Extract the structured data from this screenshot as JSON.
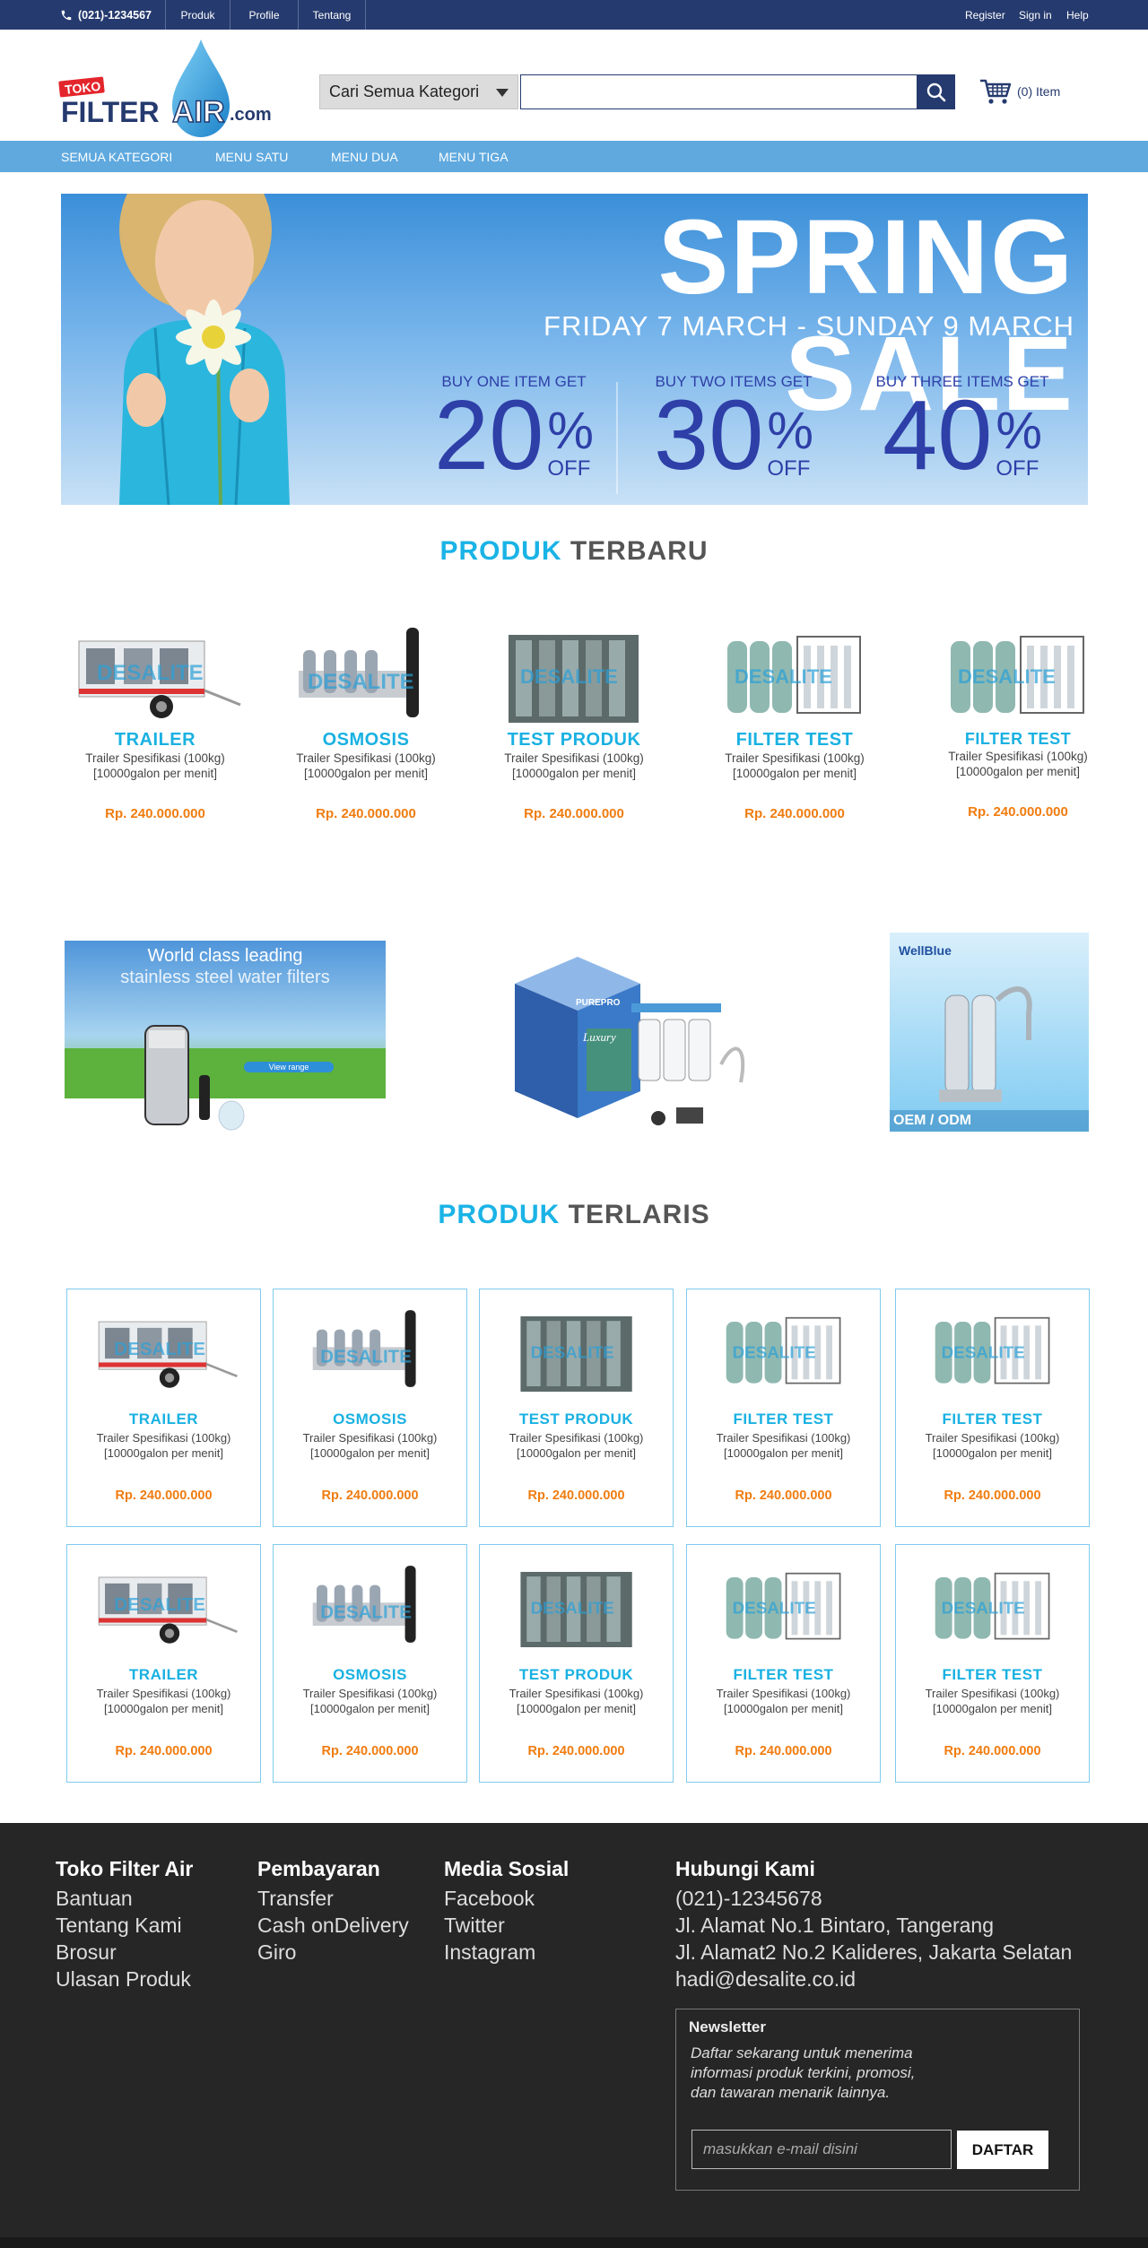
{
  "topbar": {
    "phone": "(021)-1234567",
    "links": [
      "Produk",
      "Profile",
      "Tentang"
    ],
    "right_links": [
      "Register",
      "Sign in",
      "Help"
    ]
  },
  "header": {
    "logo": {
      "top_text": "TOKO",
      "main_text": "FILTER",
      "accent_text": "AIR",
      "suffix": ".com"
    },
    "category_select": "Cari Semua Kategori",
    "search_value": "",
    "cart_label": "(0) Item"
  },
  "nav": {
    "items": [
      "SEMUA KATEGORI",
      "MENU SATU",
      "MENU DUA",
      "MENU TIGA"
    ]
  },
  "banner": {
    "title": "SPRING SALE",
    "subtitle": "FRIDAY 7 MARCH - SUNDAY 9 MARCH",
    "offers": [
      {
        "label": "BUY ONE ITEM GET",
        "value": "20",
        "pct": "%",
        "off": "OFF"
      },
      {
        "label": "BUY TWO ITEMS GET",
        "value": "30",
        "pct": "%",
        "off": "OFF"
      },
      {
        "label": "BUY THREE ITEMS GET",
        "value": "40",
        "pct": "%",
        "off": "OFF"
      }
    ]
  },
  "new_products": {
    "title_a": "PRODUK",
    "title_b": "TERBARU",
    "items": [
      {
        "name": "TRAILER",
        "desc1": "Trailer Spesifikasi (100kg)",
        "desc2": "[10000galon per menit]",
        "price": "Rp. 240.000.000"
      },
      {
        "name": "OSMOSIS",
        "desc1": "Trailer Spesifikasi (100kg)",
        "desc2": "[10000galon per menit]",
        "price": "Rp. 240.000.000"
      },
      {
        "name": "TEST PRODUK",
        "desc1": "Trailer Spesifikasi (100kg)",
        "desc2": "[10000galon per menit]",
        "price": "Rp. 240.000.000"
      },
      {
        "name": "FILTER TEST",
        "desc1": "Trailer Spesifikasi (100kg)",
        "desc2": "[10000galon per menit]",
        "price": "Rp. 240.000.000"
      },
      {
        "name": "FILTER TEST",
        "desc1": "Trailer Spesifikasi (100kg)",
        "desc2": "[10000galon per menit]",
        "price": "Rp. 240.000.000"
      }
    ]
  },
  "promos": {
    "left": {
      "headline1": "World class leading",
      "headline2": "stainless steel water filters",
      "button": "View range"
    },
    "middle": {
      "brand": "PUREPRO",
      "product": "Luxury"
    },
    "right": {
      "brand": "WellBlue",
      "caption": "OEM / ODM"
    }
  },
  "best_sellers": {
    "title_a": "PRODUK",
    "title_b": "TERLARIS",
    "rows": [
      [
        {
          "name": "TRAILER",
          "desc1": "Trailer Spesifikasi (100kg)",
          "desc2": "[10000galon per menit]",
          "price": "Rp. 240.000.000"
        },
        {
          "name": "OSMOSIS",
          "desc1": "Trailer Spesifikasi (100kg)",
          "desc2": "[10000galon per menit]",
          "price": "Rp. 240.000.000"
        },
        {
          "name": "TEST PRODUK",
          "desc1": "Trailer Spesifikasi (100kg)",
          "desc2": "[10000galon per menit]",
          "price": "Rp. 240.000.000"
        },
        {
          "name": "FILTER TEST",
          "desc1": "Trailer Spesifikasi (100kg)",
          "desc2": "[10000galon per menit]",
          "price": "Rp. 240.000.000"
        },
        {
          "name": "FILTER TEST",
          "desc1": "Trailer Spesifikasi (100kg)",
          "desc2": "[10000galon per menit]",
          "price": "Rp. 240.000.000"
        }
      ],
      [
        {
          "name": "TRAILER",
          "desc1": "Trailer Spesifikasi (100kg)",
          "desc2": "[10000galon per menit]",
          "price": "Rp. 240.000.000"
        },
        {
          "name": "OSMOSIS",
          "desc1": "Trailer Spesifikasi (100kg)",
          "desc2": "[10000galon per menit]",
          "price": "Rp. 240.000.000"
        },
        {
          "name": "TEST PRODUK",
          "desc1": "Trailer Spesifikasi (100kg)",
          "desc2": "[10000galon per menit]",
          "price": "Rp. 240.000.000"
        },
        {
          "name": "FILTER TEST",
          "desc1": "Trailer Spesifikasi (100kg)",
          "desc2": "[10000galon per menit]",
          "price": "Rp. 240.000.000"
        },
        {
          "name": "FILTER TEST",
          "desc1": "Trailer Spesifikasi (100kg)",
          "desc2": "[10000galon per menit]",
          "price": "Rp. 240.000.000"
        }
      ]
    ]
  },
  "footer": {
    "col1": {
      "title": "Toko Filter Air",
      "links": [
        "Bantuan",
        "Tentang Kami",
        "Brosur",
        "Ulasan Produk"
      ]
    },
    "col2": {
      "title": "Pembayaran",
      "links": [
        "Transfer",
        "Cash onDelivery",
        "Giro"
      ]
    },
    "col3": {
      "title": "Media Sosial",
      "links": [
        "Facebook",
        "Twitter",
        "Instagram"
      ]
    },
    "col4": {
      "title": "Hubungi Kami",
      "lines": [
        "(021)-12345678",
        "Jl. Alamat No.1 Bintaro, Tangerang",
        "Jl. Alamat2 No.2 Kalideres, Jakarta Selatan",
        "hadi@desalite.co.id"
      ]
    },
    "newsletter": {
      "title": "Newsletter",
      "text1": "Daftar sekarang untuk menerima",
      "text2": "informasi produk terkini, promosi,",
      "text3": "dan tawaran menarik lainnya.",
      "placeholder": "masukkan e-mail disini",
      "button": "DAFTAR"
    }
  },
  "colors": {
    "navy": "#253a6e",
    "nav_blue": "#5fa9df",
    "accent_cyan": "#1ab3e6",
    "price_orange": "#f07c10",
    "footer_bg": "#262626"
  },
  "icons": [
    "phone-icon",
    "search-icon",
    "cart-icon",
    "dropdown-arrow-icon"
  ]
}
